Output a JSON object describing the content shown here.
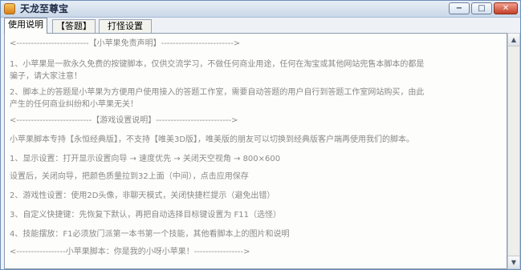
{
  "window": {
    "title": "天龙至尊宝"
  },
  "controls": {
    "minimize": "−",
    "maximize": "□",
    "close": "✕"
  },
  "tabs": [
    {
      "label": "使用说明",
      "active": true
    },
    {
      "label": "【答题】",
      "active": false
    },
    {
      "label": "打怪设置",
      "active": false
    }
  ],
  "content": {
    "lines": [
      "<-------------------------【小苹果免责声明】------------------------->",
      "1、小苹果是一款永久免费的按键脚本，仅供交流学习，不做任何商业用途，任何在淘宝或其他网站兜售本脚本的都是",
      "骗子，请大家注意！",
      "2、脚本上的答题是小苹果为方便用户使用接入的答题工作室，需要自动答题的用户自行到答题工作室网站购买，由此",
      "产生的任何商业纠纷和小苹果无关！",
      "<--------------------------【游戏设置说明】-------------------------->",
      "小苹果脚本专持【永恒经典版】，不支持【唯美3D版】，唯美版的朋友可以切换到经典版客户端再使用我们的脚本。",
      "1、显示设置：打开显示设置向导 → 速度优先 → 关闭天空视角 → 800×600",
      "设置后，关闭向导，把颜色质量拉到32上面（中间），点击应用保存",
      "2、游戏性设置：使用2D头像，非聊天模式，关闭快捷栏提示（避免出错）",
      "3、自定义快捷键：先恢复下默认，再把自动选择目标键设置为 F11（选怪）",
      "4、技能摆放：F1必须放门派第一本书第一个技能，其他看脚本上的图片和说明",
      "<-----------------小苹果脚本：你是我的小呀小苹果！----------------->"
    ]
  },
  "scrollbar": {
    "up": "▲",
    "down": "▼"
  }
}
